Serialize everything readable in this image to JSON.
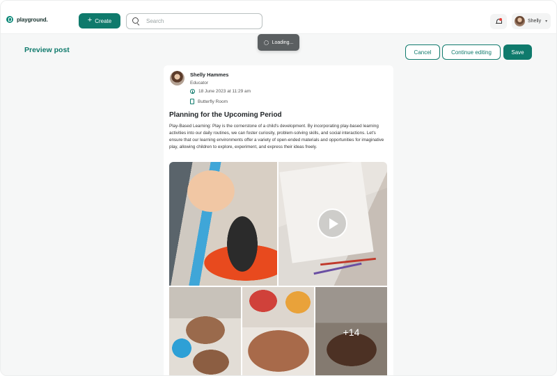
{
  "app": {
    "name": "playground."
  },
  "header": {
    "create_label": "Create",
    "search_placeholder": "Search",
    "user_name": "Shelly"
  },
  "toast": {
    "text": "Loading..."
  },
  "page": {
    "title": "Preview post"
  },
  "actions": {
    "cancel": "Cancel",
    "continue": "Continue editing",
    "save": "Save"
  },
  "post": {
    "author": "Shelly Hammes",
    "role": "Educator",
    "date": "18 June 2023 at 11:29 am",
    "room": "Butterfly Room",
    "title": "Planning for the Upcoming Period",
    "body": "Play-Based Learning: Play is the cornerstone of a child's development. By incorporating play-based learning activities into our daily routines, we can foster curiosity, problem-solving skills, and social interactions. Let's ensure that our learning environments offer a variety of open-ended materials and opportunities for imaginative play, allowing children to explore, experiment, and express their ideas freely.",
    "more_media": "+14"
  },
  "colors": {
    "brand": "#0f7a6c",
    "notification": "#e5403a"
  }
}
